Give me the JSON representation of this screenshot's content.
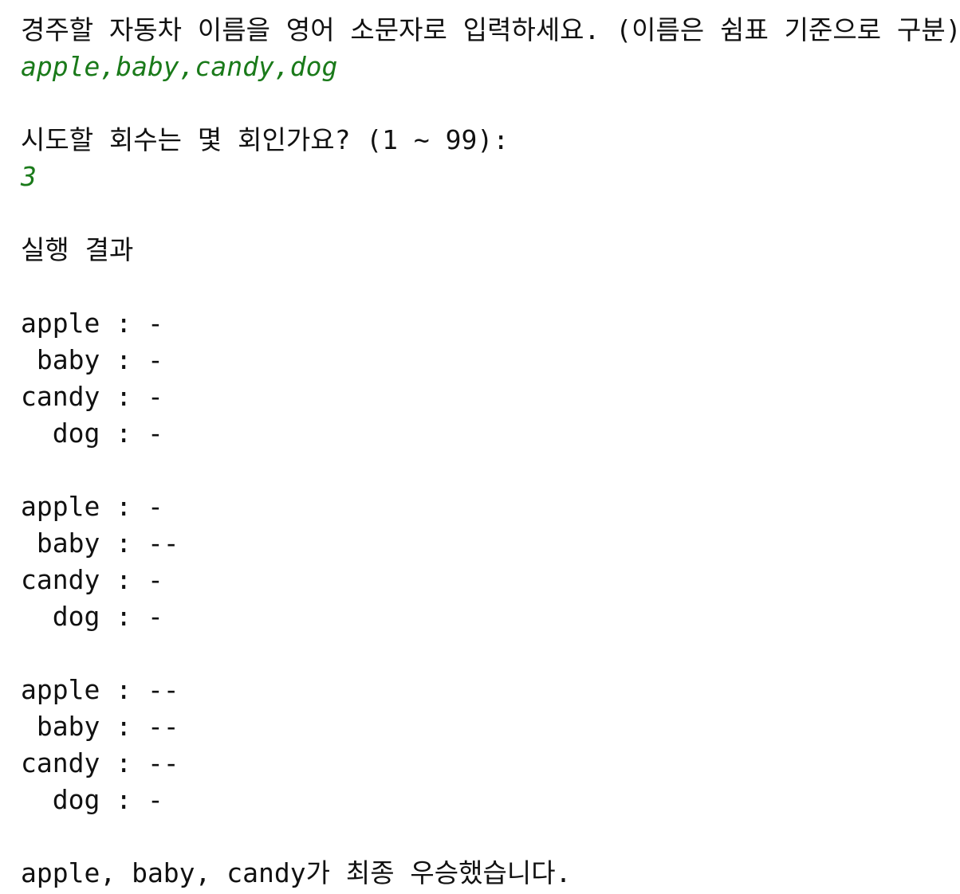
{
  "prompts": {
    "car_names": "경주할 자동차 이름을 영어 소문자로 입력하세요. (이름은 쉼표 기준으로 구분):",
    "car_names_input": "apple,baby,candy,dog",
    "attempts": "시도할 회수는 몇 회인가요? (1 ~ 99):",
    "attempts_input": "3"
  },
  "result_header": "실행 결과",
  "rounds": [
    [
      "apple : -",
      " baby : -",
      "candy : -",
      "  dog : -"
    ],
    [
      "apple : -",
      " baby : --",
      "candy : -",
      "  dog : -"
    ],
    [
      "apple : --",
      " baby : --",
      "candy : --",
      "  dog : -"
    ]
  ],
  "final_message": "apple, baby, candy가 최종 우승했습니다.",
  "colors": {
    "text": "#111111",
    "input": "#1a7a1a",
    "background": "#ffffff"
  }
}
